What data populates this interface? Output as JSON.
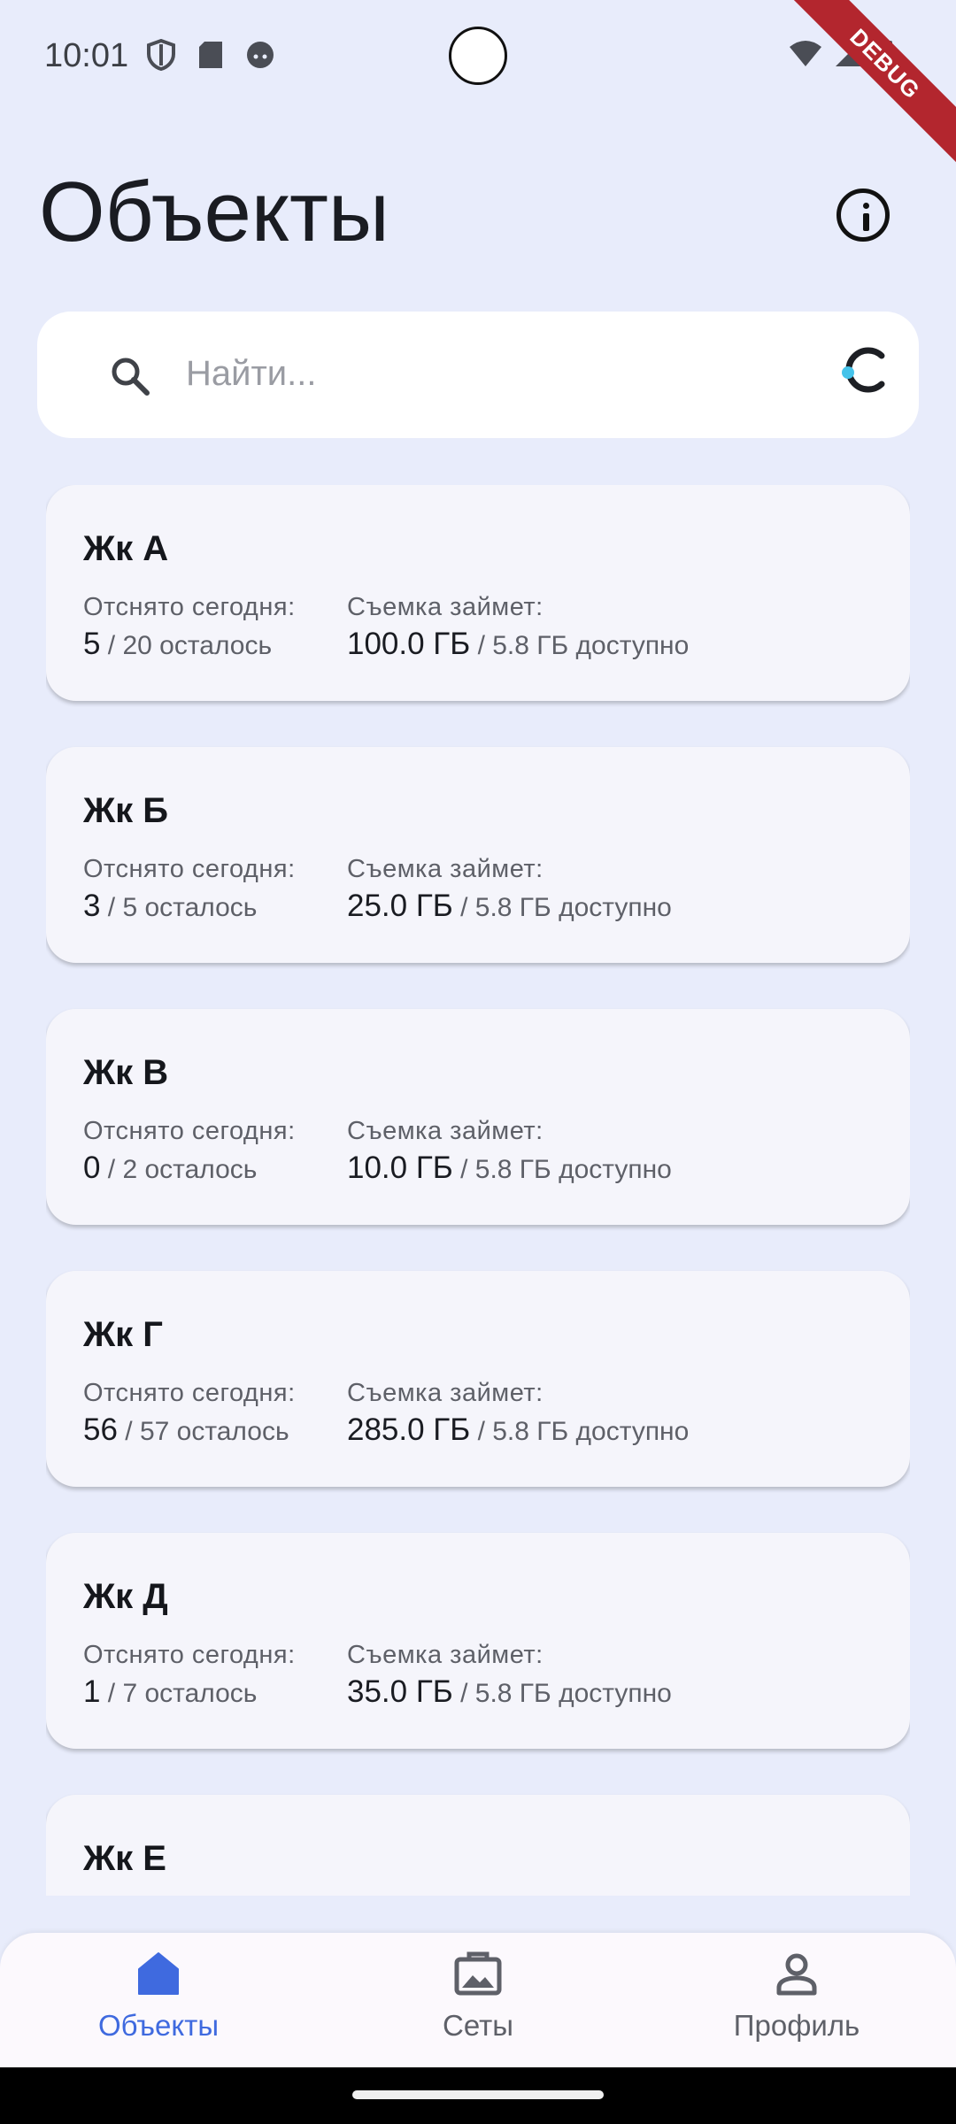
{
  "status_bar": {
    "time": "10:01",
    "icons": [
      "shield-icon",
      "sd-card-icon",
      "face-icon",
      "wifi-icon",
      "signal-icon",
      "battery-icon"
    ],
    "debug_label": "DEBUG"
  },
  "header": {
    "title": "Объекты",
    "info_icon": "info-icon"
  },
  "search": {
    "placeholder": "Найти...",
    "value": ""
  },
  "labels": {
    "shot_today": "Отснято сегодня:",
    "shoot_takes": "Съемка займет:"
  },
  "objects": [
    {
      "name": "Жк А",
      "shot": "5",
      "shot_sub": " / 20 осталось",
      "size": "100.0 ГБ",
      "size_sub": " / 5.8 ГБ доступно"
    },
    {
      "name": "Жк Б",
      "shot": "3",
      "shot_sub": " / 5 осталось",
      "size": "25.0 ГБ",
      "size_sub": " / 5.8 ГБ доступно"
    },
    {
      "name": "Жк В",
      "shot": "0",
      "shot_sub": " / 2 осталось",
      "size": "10.0 ГБ",
      "size_sub": " / 5.8 ГБ доступно"
    },
    {
      "name": "Жк Г",
      "shot": "56",
      "shot_sub": " / 57 осталось",
      "size": "285.0 ГБ",
      "size_sub": " / 5.8 ГБ доступно"
    },
    {
      "name": "Жк Д",
      "shot": "1",
      "shot_sub": " / 7 осталось",
      "size": "35.0 ГБ",
      "size_sub": " / 5.8 ГБ доступно"
    },
    {
      "name": "Жк Е"
    }
  ],
  "bottom_nav": {
    "items": [
      {
        "label": "Объекты",
        "icon": "home-icon",
        "active": true
      },
      {
        "label": "Сеты",
        "icon": "image-icon",
        "active": false
      },
      {
        "label": "Профиль",
        "icon": "person-icon",
        "active": false
      }
    ]
  },
  "colors": {
    "background": "#e8ecfb",
    "card": "#f5f5fb",
    "accent": "#3f6adf",
    "debug_ribbon": "#b3262e"
  }
}
